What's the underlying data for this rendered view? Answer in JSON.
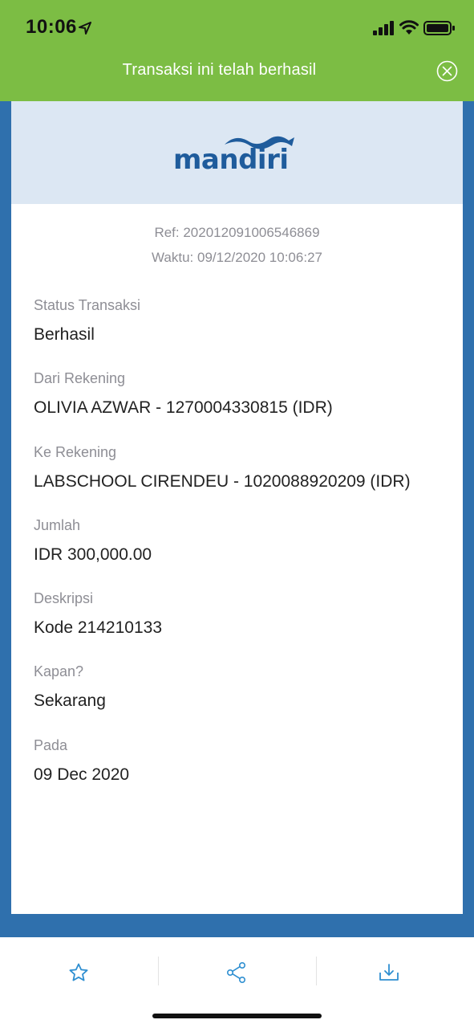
{
  "status_bar": {
    "time": "10:06"
  },
  "banner": {
    "title": "Transaksi ini telah berhasil"
  },
  "logo": {
    "text": "mandiri",
    "color": "#1f5c9c"
  },
  "receipt": {
    "ref": "Ref: 202012091006546869",
    "waktu": "Waktu: 09/12/2020 10:06:27",
    "fields": [
      {
        "label": "Status Transaksi",
        "value": "Berhasil"
      },
      {
        "label": "Dari Rekening",
        "value": "OLIVIA AZWAR - 1270004330815 (IDR)"
      },
      {
        "label": "Ke Rekening",
        "value": "LABSCHOOL CIRENDEU - 1020088920209 (IDR)"
      },
      {
        "label": "Jumlah",
        "value": "IDR 300,000.00"
      },
      {
        "label": "Deskripsi",
        "value": "Kode 214210133"
      },
      {
        "label": "Kapan?",
        "value": "Sekarang"
      },
      {
        "label": "Pada",
        "value": "09 Dec 2020"
      }
    ]
  },
  "toolbar": {
    "icons": [
      "star-icon",
      "share-icon",
      "download-icon"
    ]
  },
  "colors": {
    "banner": "#7cbd44",
    "frame": "#2f70ad",
    "header_bg": "#dce7f3",
    "accent": "#2f8fd1"
  }
}
